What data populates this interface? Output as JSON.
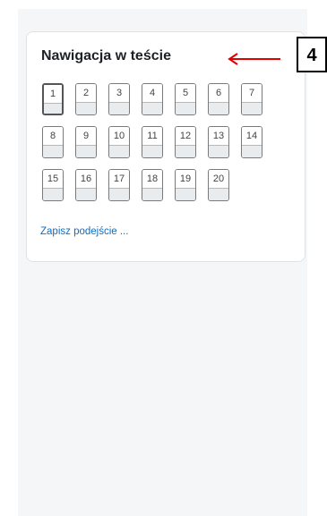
{
  "quiz_navigation": {
    "title": "Nawigacja w teście",
    "questions": [
      "1",
      "2",
      "3",
      "4",
      "5",
      "6",
      "7",
      "8",
      "9",
      "10",
      "11",
      "12",
      "13",
      "14",
      "15",
      "16",
      "17",
      "18",
      "19",
      "20"
    ],
    "current_question": "1",
    "save_link": "Zapisz podejście ..."
  },
  "annotation": {
    "callout_number": "4",
    "arrow_color": "#e00000"
  },
  "colors": {
    "link": "#0f6cbf",
    "panel_background": "#f5f6f8"
  }
}
